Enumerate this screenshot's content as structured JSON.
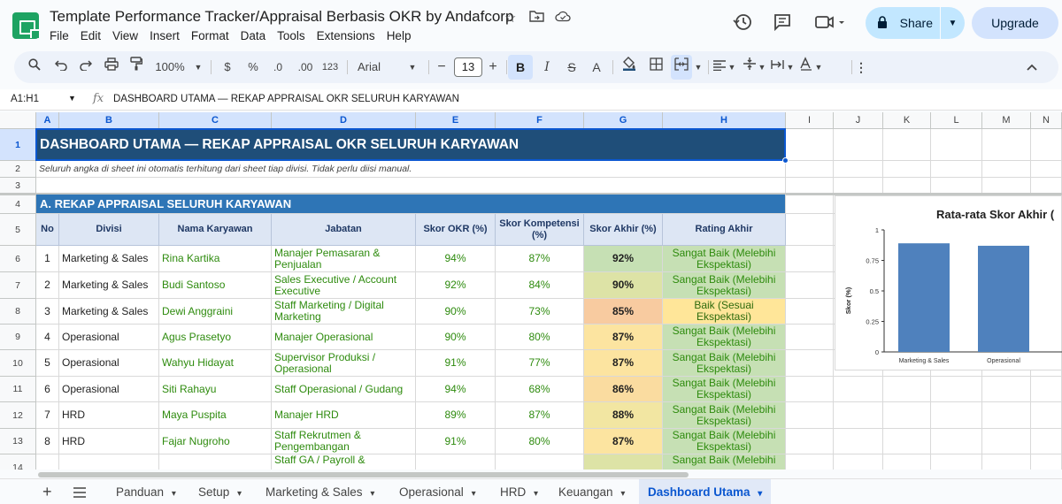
{
  "app": {
    "title": "Template Performance Tracker/Appraisal Berbasis OKR by Andafcorp",
    "menu": [
      "File",
      "Edit",
      "View",
      "Insert",
      "Format",
      "Data",
      "Tools",
      "Extensions",
      "Help"
    ],
    "share_label": "Share",
    "upgrade_label": "Upgrade"
  },
  "toolbar": {
    "zoom": "100%",
    "currency": "$",
    "percent": "%",
    "dec_decrease": ".0",
    "dec_increase": ".00",
    "number_format": "123",
    "font": "Arial",
    "font_size": "13",
    "minus": "−",
    "plus": "+",
    "bold": "B",
    "italic": "I",
    "strike": "S",
    "text_color": "A"
  },
  "formula_bar": {
    "name_box": "A1:H1",
    "fx": "fx",
    "content": "DASHBOARD UTAMA — REKAP APPRAISAL OKR SELURUH KARYAWAN"
  },
  "columns": [
    "A",
    "B",
    "C",
    "D",
    "E",
    "F",
    "G",
    "H",
    "I",
    "J",
    "K",
    "L",
    "M",
    "N"
  ],
  "rows": [
    "1",
    "2",
    "3",
    "4",
    "5",
    "6",
    "7",
    "8",
    "9",
    "10",
    "11",
    "12",
    "13",
    "14"
  ],
  "sheet": {
    "banner": "DASHBOARD UTAMA — REKAP APPRAISAL OKR SELURUH KARYAWAN",
    "subtitle": "Seluruh angka di sheet ini otomatis terhitung dari sheet tiap divisi. Tidak perlu diisi manual.",
    "section_a": "A. REKAP APPRAISAL SELURUH KARYAWAN",
    "headers": [
      "No",
      "Divisi",
      "Nama Karyawan",
      "Jabatan",
      "Skor OKR (%)",
      "Skor Kompetensi (%)",
      "Skor Akhir (%)",
      "Rating Akhir"
    ],
    "data_rows": [
      {
        "no": "1",
        "divisi": "Marketing & Sales",
        "nama": "Rina Kartika",
        "jabatan": "Manajer Pemasaran & Penjualan",
        "okr": "94%",
        "komp": "87%",
        "akhir": "92%",
        "rating": "Sangat Baik (Melebihi Ekspektasi)",
        "akhir_color": "#c6e0b4",
        "rating_color": "#c6e0b4"
      },
      {
        "no": "2",
        "divisi": "Marketing & Sales",
        "nama": "Budi Santoso",
        "jabatan": "Sales Executive / Account Executive",
        "okr": "92%",
        "komp": "84%",
        "akhir": "90%",
        "rating": "Sangat Baik (Melebihi Ekspektasi)",
        "akhir_color": "#dde3a6",
        "rating_color": "#c6e0b4"
      },
      {
        "no": "3",
        "divisi": "Marketing & Sales",
        "nama": "Dewi Anggraini",
        "jabatan": "Staff Marketing / Digital Marketing",
        "okr": "90%",
        "komp": "73%",
        "akhir": "85%",
        "rating": "Baik (Sesuai Ekspektasi)",
        "akhir_color": "#f8cba0",
        "rating_color": "#ffe699"
      },
      {
        "no": "4",
        "divisi": "Operasional",
        "nama": "Agus Prasetyo",
        "jabatan": "Manajer Operasional",
        "okr": "90%",
        "komp": "80%",
        "akhir": "87%",
        "rating": "Sangat Baik (Melebihi Ekspektasi)",
        "akhir_color": "#fce4a0",
        "rating_color": "#c6e0b4"
      },
      {
        "no": "5",
        "divisi": "Operasional",
        "nama": "Wahyu Hidayat",
        "jabatan": "Supervisor Produksi / Operasional",
        "okr": "91%",
        "komp": "77%",
        "akhir": "87%",
        "rating": "Sangat Baik (Melebihi Ekspektasi)",
        "akhir_color": "#fce4a0",
        "rating_color": "#c6e0b4"
      },
      {
        "no": "6",
        "divisi": "Operasional",
        "nama": "Siti Rahayu",
        "jabatan": "Staff Operasional / Gudang",
        "okr": "94%",
        "komp": "68%",
        "akhir": "86%",
        "rating": "Sangat Baik (Melebihi Ekspektasi)",
        "akhir_color": "#fadca0",
        "rating_color": "#c6e0b4"
      },
      {
        "no": "7",
        "divisi": "HRD",
        "nama": "Maya Puspita",
        "jabatan": "Manajer HRD",
        "okr": "89%",
        "komp": "87%",
        "akhir": "88%",
        "rating": "Sangat Baik (Melebihi Ekspektasi)",
        "akhir_color": "#f2e6a2",
        "rating_color": "#c6e0b4"
      },
      {
        "no": "8",
        "divisi": "HRD",
        "nama": "Fajar Nugroho",
        "jabatan": "Staff Rekrutmen & Pengembangan",
        "okr": "91%",
        "komp": "80%",
        "akhir": "87%",
        "rating": "Sangat Baik (Melebihi Ekspektasi)",
        "akhir_color": "#fce4a0",
        "rating_color": "#c6e0b4"
      },
      {
        "no": "",
        "divisi": "",
        "nama": "",
        "jabatan": "Staff GA / Payroll &",
        "okr": "",
        "komp": "",
        "akhir": "",
        "rating": "Sangat Baik (Melebihi",
        "akhir_color": "#dde3a6",
        "rating_color": "#c6e0b4"
      }
    ]
  },
  "chart_data": {
    "type": "bar",
    "title": "Rata-rata Skor Akhir (",
    "ylabel": "Skor (%)",
    "categories": [
      "Marketing & Sales",
      "Operasional"
    ],
    "values": [
      0.89,
      0.87
    ],
    "ylim": [
      0,
      1
    ],
    "yticks": [
      "0",
      "0.25",
      "0.5",
      "0.75",
      "1"
    ],
    "bar_color": "#4f81bd",
    "grid": false
  },
  "tabs": [
    {
      "label": "Panduan",
      "active": false
    },
    {
      "label": "Setup",
      "active": false
    },
    {
      "label": "Marketing & Sales",
      "active": false
    },
    {
      "label": "Operasional",
      "active": false
    },
    {
      "label": "HRD",
      "active": false
    },
    {
      "label": "Keuangan",
      "active": false
    },
    {
      "label": "Dashboard Utama",
      "active": true
    }
  ],
  "colors": {
    "banner": "#1f4e79",
    "section": "#2e75b6",
    "header": "#dde6f4",
    "text_green": "#2e8b0e"
  }
}
